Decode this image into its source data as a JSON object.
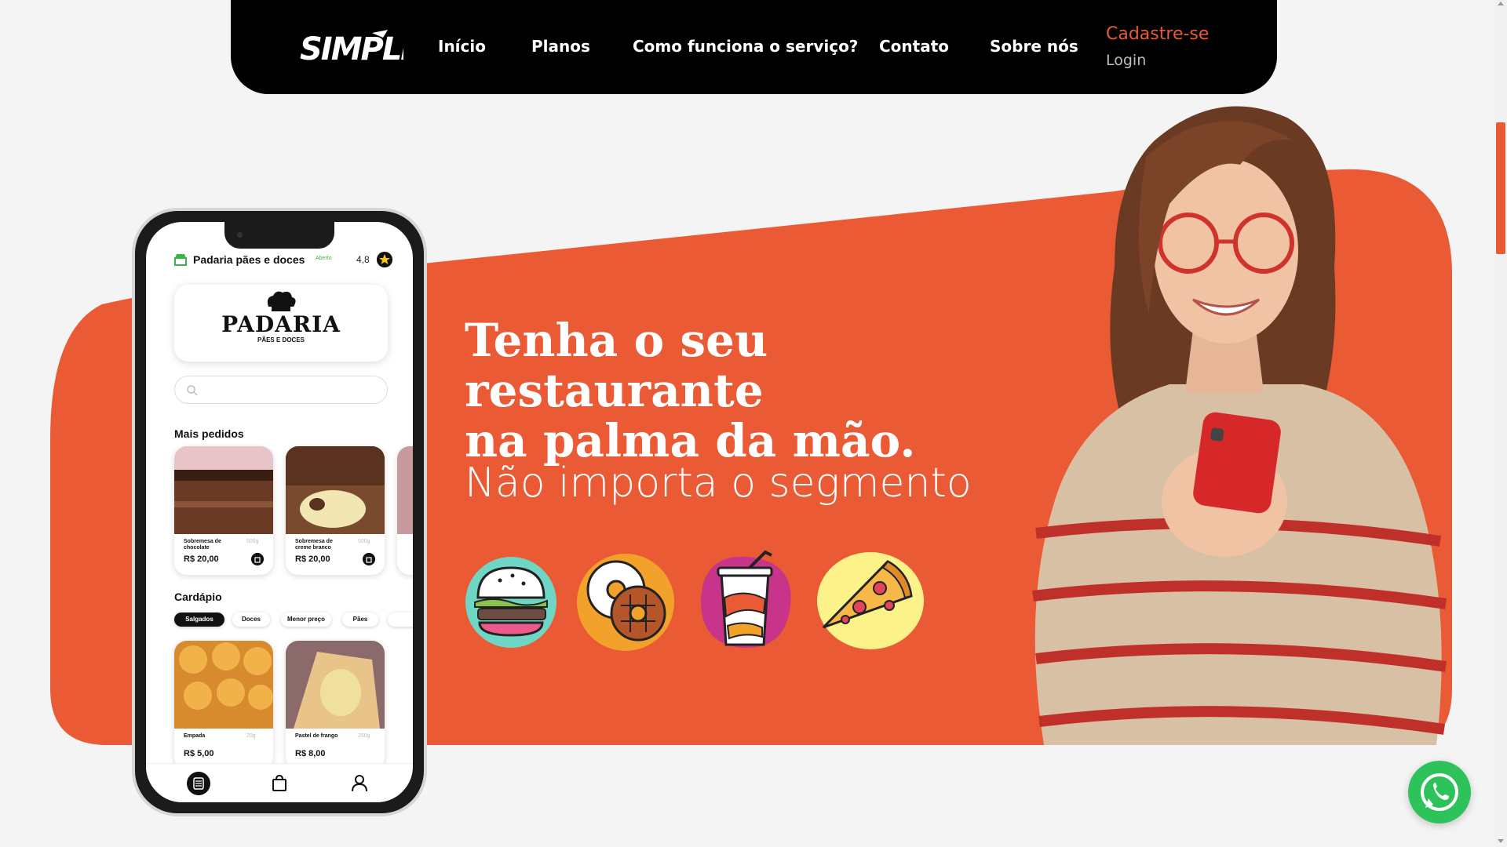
{
  "brand": {
    "logo_text": "SIMPLE"
  },
  "nav": {
    "links": [
      "Início",
      "Planos",
      "Como funciona o serviço?",
      "Contato",
      "Sobre nós"
    ],
    "signup": "Cadastre-se",
    "login": "Login"
  },
  "hero": {
    "headline_1": "Tenha o seu restaurante",
    "headline_2": "na palma da mão.",
    "subheadline": "Não importa o segmento",
    "food_icons": [
      "burger-icon",
      "donuts-icon",
      "soda-cup-icon",
      "pizza-slice-icon"
    ]
  },
  "phone": {
    "store_name": "Padaria pães e doces",
    "store_status": "Aberto",
    "rating": "4,8",
    "brand_title": "PADARIA",
    "brand_subtitle": "PÃES E DOCES",
    "most_ordered_label": "Mais pedidos",
    "most_ordered": [
      {
        "name": "Sobremesa de chocolate",
        "weight": "500g",
        "price": "R$ 20,00"
      },
      {
        "name": "Sobremesa de creme branco",
        "weight": "500g",
        "price": "R$ 20,00"
      }
    ],
    "menu_label": "Cardápio",
    "chips": [
      "Salgados",
      "Doces",
      "Menor preço",
      "Pães"
    ],
    "menu_items": [
      {
        "name": "Empada",
        "weight": "20g",
        "price": "R$ 5,00"
      },
      {
        "name": "Pastel de frango",
        "weight": "250g",
        "price": "R$ 8,00"
      }
    ],
    "tabs": [
      "menu-tab-icon",
      "bag-tab-icon",
      "profile-tab-icon"
    ]
  },
  "colors": {
    "accent": "#ea5a35",
    "nav_bg": "#000000",
    "page_bg": "#f4f4f4",
    "whatsapp": "#2ec35a"
  }
}
